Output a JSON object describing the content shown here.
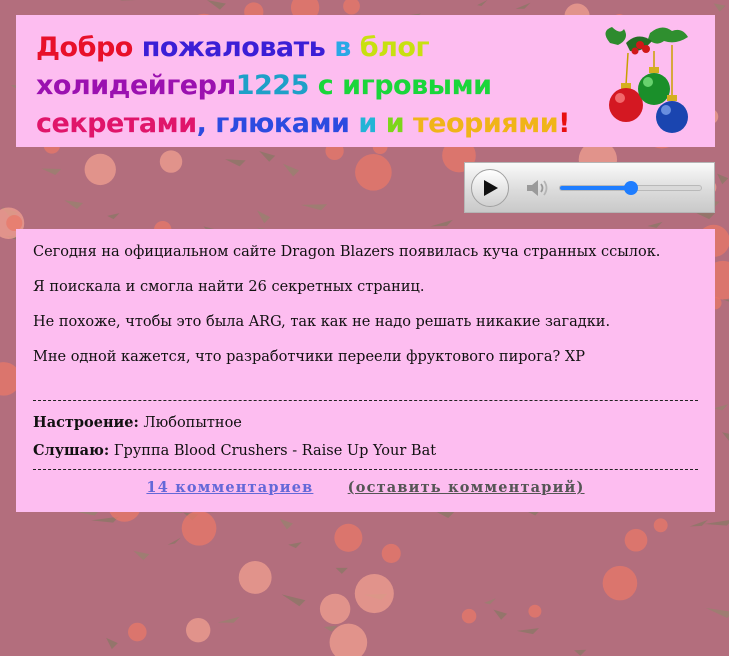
{
  "header": {
    "title_segments": [
      {
        "text": "Добро ",
        "color": "#e8102a"
      },
      {
        "text": "пожаловать ",
        "color": "#3b1fd6"
      },
      {
        "text": "в ",
        "color": "#2aa8e6"
      },
      {
        "text": "блог",
        "color": "#c8e010"
      },
      {
        "text": "холидейгерл",
        "color": "#9b11b0"
      },
      {
        "text": "1225 ",
        "color": "#1ea0c8"
      },
      {
        "text": "с игровыми",
        "color": "#1ad63a"
      },
      {
        "text": "секретами",
        "color": "#e0156a"
      },
      {
        "text": ", глюками ",
        "color": "#2c4be0"
      },
      {
        "text": "и ",
        "color": "#23b4d6"
      },
      {
        "text": "и ",
        "color": "#7cd61a"
      },
      {
        "text": "теориями",
        "color": "#f0b418"
      },
      {
        "text": "!",
        "color": "#e81010"
      }
    ],
    "ornament_icon": "christmas-ornaments-icon"
  },
  "player": {
    "play_icon": "play-icon",
    "volume_icon": "volume-icon",
    "volume_level": 0.5
  },
  "post": {
    "paragraphs": [
      "Сегодня на официальном сайте Dragon Blazers появилась куча странных ссылок.",
      "Я поискала и смогла найти 26 секретных страниц.",
      "Не похоже, чтобы это была ARG, так как не надо решать никакие загадки.",
      "Мне одной кажется, что разработчики переели фруктового пирога? XP"
    ],
    "mood_label": "Настроение:",
    "mood_value": "Любопытное",
    "music_label": "Слушаю:",
    "music_value": "Группа Blood Crushers - Raise Up Your Bat",
    "comments_link": "14 комментариев",
    "leave_comment_link": "(оставить комментарий)"
  },
  "colors": {
    "panel": "#fdbdf0",
    "slider": "#1e7dff"
  }
}
